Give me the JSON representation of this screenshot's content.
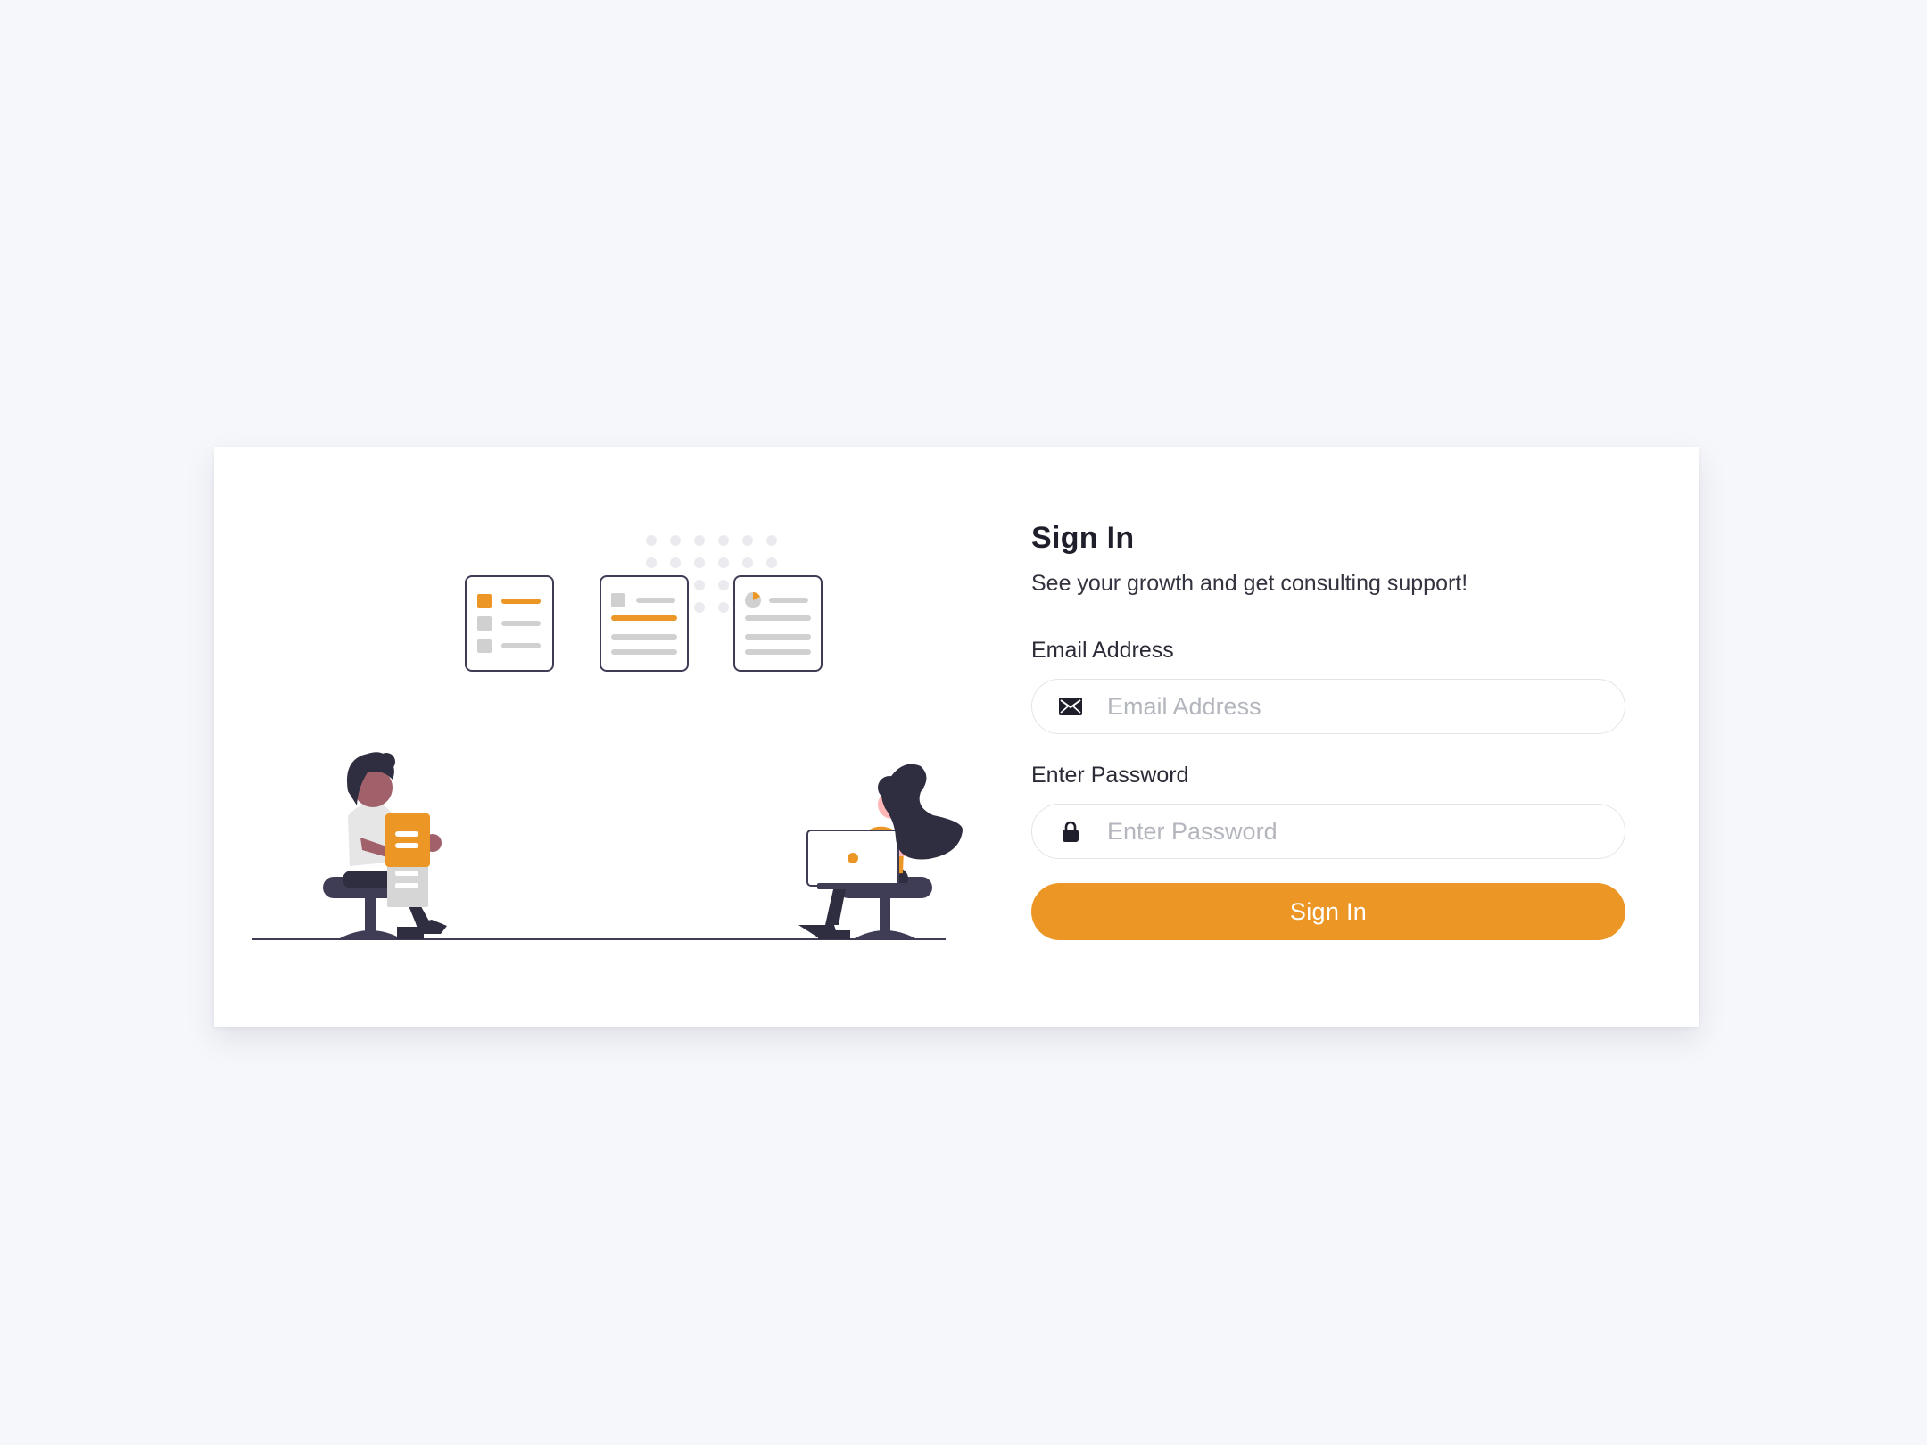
{
  "colors": {
    "accent": "#ec9725",
    "background": "#f6f7fb",
    "card": "#ffffff",
    "dark": "#2f2e41"
  },
  "form": {
    "title": "Sign In",
    "subtitle": "See your growth and get consulting support!",
    "email": {
      "label": "Email Address",
      "placeholder": "Email Address",
      "value": "",
      "icon": "envelope-icon"
    },
    "password": {
      "label": "Enter Password",
      "placeholder": "Enter Password",
      "value": "",
      "icon": "lock-icon"
    },
    "submit_label": "Sign In"
  },
  "illustration": {
    "name": "consulting-illustration"
  }
}
